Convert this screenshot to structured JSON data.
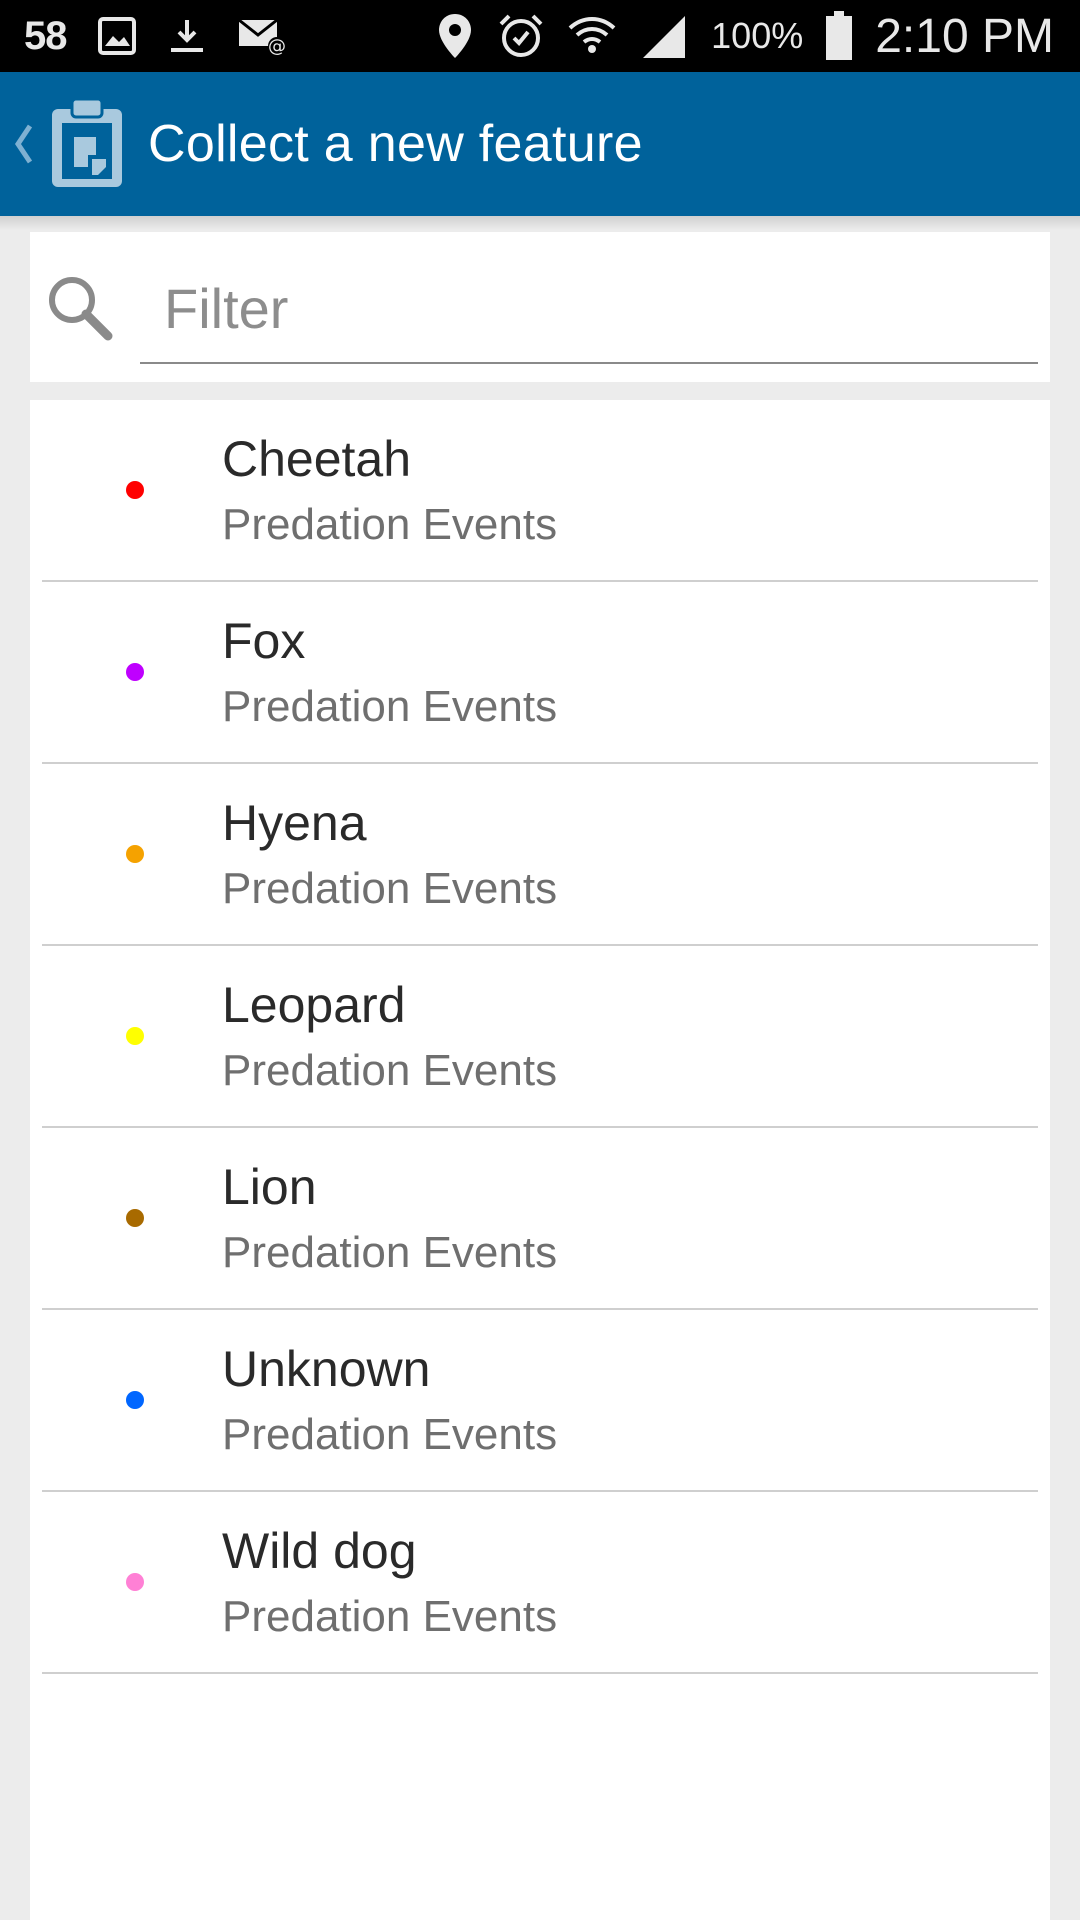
{
  "status_bar": {
    "notification_count": "58",
    "battery_percent": "100%",
    "time": "2:10 PM",
    "icons": [
      "image-icon",
      "download-icon",
      "email-icon",
      "location-icon",
      "alarm-icon",
      "wifi-icon",
      "signal-icon",
      "battery-icon"
    ]
  },
  "app_bar": {
    "title": "Collect a new feature",
    "back_icon": "chevron-left-icon",
    "logo_icon": "clipboard-app-icon",
    "color": "#00629b"
  },
  "filter": {
    "placeholder": "Filter",
    "value": "",
    "icon": "search-icon"
  },
  "features": [
    {
      "name": "Cheetah",
      "layer": "Predation Events",
      "color": "#ff0000"
    },
    {
      "name": "Fox",
      "layer": "Predation Events",
      "color": "#bf00ff"
    },
    {
      "name": "Hyena",
      "layer": "Predation Events",
      "color": "#f5a200"
    },
    {
      "name": "Leopard",
      "layer": "Predation Events",
      "color": "#ffff00"
    },
    {
      "name": "Lion",
      "layer": "Predation Events",
      "color": "#a86a00"
    },
    {
      "name": "Unknown",
      "layer": "Predation Events",
      "color": "#0066ff"
    },
    {
      "name": "Wild dog",
      "layer": "Predation Events",
      "color": "#ff80d5"
    }
  ]
}
